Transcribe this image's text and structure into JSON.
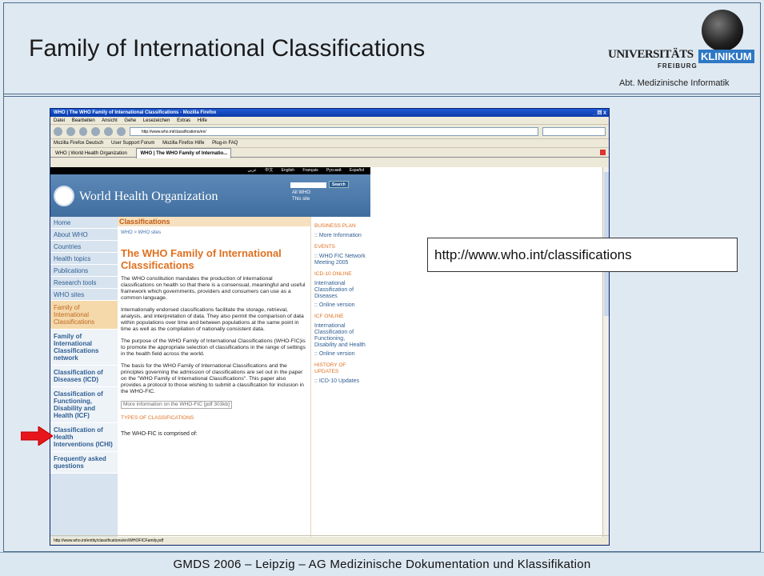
{
  "slide": {
    "title": "Family of International Classifications",
    "logo": {
      "universitaets": "UNIVERSITÄTS",
      "freiburg": "FREIBURG",
      "klinikum": "KLINIKUM",
      "dept": "Abt. Medizinische Informatik"
    },
    "footer": "GMDS 2006 – Leipzig – AG Medizinische Dokumentation und Klassifikation",
    "url_callout": "http://www.who.int/classifications"
  },
  "browser": {
    "window_title": "WHO | The WHO Family of International Classifications - Mozilla Firefox",
    "window_buttons": "_ 回 X",
    "menu": [
      "Datei",
      "Bearbeiten",
      "Ansicht",
      "Gehe",
      "Lesezeichen",
      "Extras",
      "Hilfe"
    ],
    "url": "http://www.who.int/classifications/en/",
    "bookmarks": [
      "Mozilla Firefox Deutsch",
      "User Support Forum",
      "Mozilla Firefox Hilfe",
      "Plug-in FAQ"
    ],
    "tabs": [
      "WHO | World Health Organization",
      "WHO | The WHO Family of Internatio..."
    ],
    "status": "http://www.who.int/entity/classifications/en/WHOFICFamily.pdf"
  },
  "who": {
    "languages": [
      "عربي",
      "中文",
      "English",
      "Français",
      "Русский",
      "Español"
    ],
    "org_name": "World Health Organization",
    "search_button": "Search",
    "search_options": [
      "All WHO",
      "This site"
    ],
    "nav": [
      "Home",
      "About WHO",
      "Countries",
      "Health topics",
      "Publications",
      "Research tools",
      "WHO sites"
    ],
    "nav_sub": "Family of International Classifications",
    "nav_children": [
      "Family of International Classifications network",
      "Classification of Diseases (ICD)",
      "Classification of Functioning, Disability and Health (ICF)",
      "Classification of Health Interventions (ICHI)",
      "Frequently asked questions"
    ],
    "section_header": "Classifications",
    "breadcrumb": "WHO > WHO sites",
    "heading": "The WHO Family of International Classifications",
    "paragraphs": [
      "The WHO constitution mandates the production of international classifications on health so that there is a consensual, meaningful and useful framework which governments, providers and consumers can use as a common language.",
      "Internationally endorsed classifications facilitate the storage, retrieval, analysis, and interpretation of data. They also permit the comparison of data within populations over time and between populations at the same point in time as well as the compilation of nationally consistent data.",
      "The purpose of the WHO Family of International Classifications (WHO-FIC)is to promote the appropriate selection of classifications in the range of settings in the health field across the world.",
      "The basis for the WHO Family of International Classifications and the principles governing the admission of classifications are set out in the paper on the \"WHO Family of International Classifications\". This paper also provides a protocol to those wishing to submit a classification for inclusion in the WHO-FIC."
    ],
    "more_link": "More information on the WHO-FIC [pdf 303kb]",
    "types_heading": "TYPES OF CLASSIFICATIONS",
    "last_line": "The WHO-FIC is comprised of:",
    "right": {
      "business_plan": "BUSINESS PLAN",
      "more_info": ":: More Information",
      "events": "EVENTS",
      "fic_meeting": ":: WHO FIC Network Meeting 2005",
      "icd_online": "ICD-10 ONLINE",
      "icd_title": "International Classification of Diseases",
      "icd_online_version": ":: Online version",
      "icf_online": "ICF ONLINE",
      "icf_title": "International Classification of Functioning, Disability and Health",
      "icf_online_version": ":: Online version",
      "history": "HISTORY OF UPDATES",
      "icd_updates": ":: ICD-10 Updates"
    }
  }
}
